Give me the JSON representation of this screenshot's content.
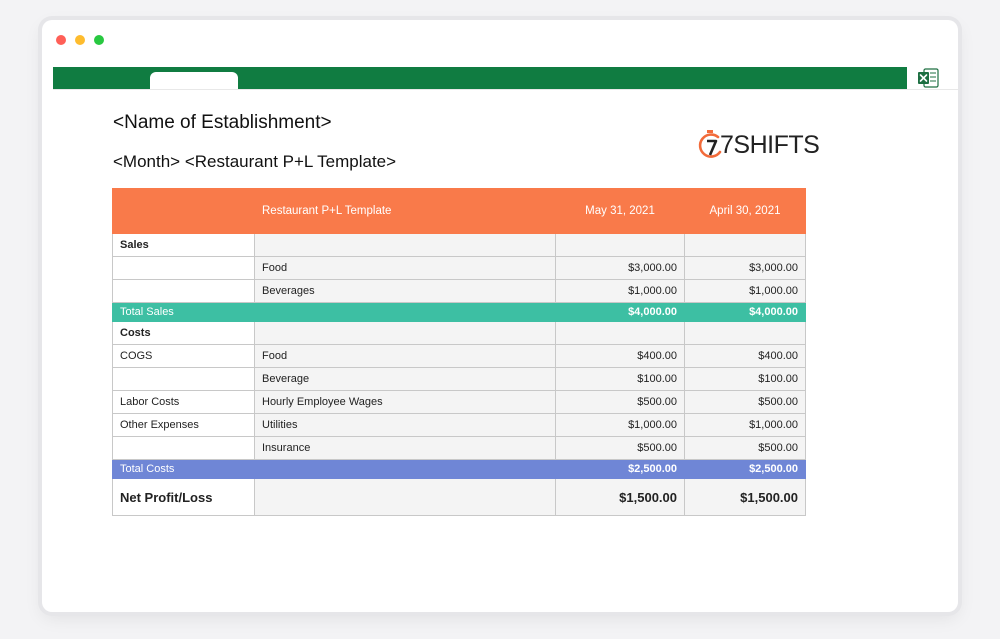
{
  "window": {
    "controls": [
      "close",
      "minimize",
      "maximize"
    ],
    "app_icon": "excel-icon"
  },
  "document": {
    "title": "<Name of Establishment>",
    "subtitle": "<Month> <Restaurant P+L Template>",
    "logo_text": "7SHIFTS",
    "logo_icon": "stopwatch-7-icon"
  },
  "table": {
    "header": [
      "",
      "Restaurant P+L Template",
      "May 31, 2021",
      "April 30, 2021"
    ],
    "rows": [
      {
        "c1": "Sales",
        "c2": "",
        "c3": "",
        "c4": ""
      },
      {
        "c1": "",
        "c2": "Food",
        "c3": "$3,000.00",
        "c4": "$3,000.00"
      },
      {
        "c1": "",
        "c2": "Beverages",
        "c3": "$1,000.00",
        "c4": "$1,000.00"
      },
      {
        "c1": "Total Sales",
        "c2": "",
        "c3": "$4,000.00",
        "c4": "$4,000.00"
      },
      {
        "c1": "Costs",
        "c2": "",
        "c3": "",
        "c4": ""
      },
      {
        "c1": "COGS",
        "c2": "Food",
        "c3": "$400.00",
        "c4": "$400.00"
      },
      {
        "c1": "",
        "c2": "Beverage",
        "c3": "$100.00",
        "c4": "$100.00"
      },
      {
        "c1": "Labor Costs",
        "c2": "Hourly Employee Wages",
        "c3": "$500.00",
        "c4": "$500.00"
      },
      {
        "c1": "Other Expenses",
        "c2": "Utilities",
        "c3": "$1,000.00",
        "c4": "$1,000.00"
      },
      {
        "c1": "",
        "c2": "Insurance",
        "c3": "$500.00",
        "c4": "$500.00"
      },
      {
        "c1": "Total Costs",
        "c2": "",
        "c3": "$2,500.00",
        "c4": "$2,500.00"
      },
      {
        "c1": "Net Profit/Loss",
        "c2": "",
        "c3": "$1,500.00",
        "c4": "$1,500.00"
      }
    ]
  },
  "colors": {
    "ribbon": "#107c41",
    "header": "#f97a4a",
    "total_sales": "#3dbfa3",
    "total_costs": "#6f86d6"
  }
}
